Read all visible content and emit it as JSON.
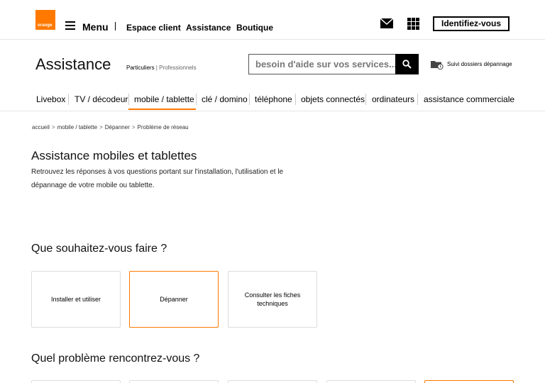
{
  "header": {
    "logo_text": "orange",
    "menu_label": "Menu",
    "links": [
      "Espace client",
      "Assistance",
      "Boutique"
    ],
    "login_label": "Identifiez-vous",
    "icons": [
      "mail-icon",
      "apps-grid-icon"
    ]
  },
  "section": {
    "title": "Assistance",
    "audience_particuliers": "Particuliers",
    "audience_sep": " | ",
    "audience_professionnels": "Professionnels",
    "search_placeholder": "besoin d'aide sur vos services...",
    "suivi_label": "Suivi dossiers dépannage"
  },
  "nav": {
    "tabs": [
      "Livebox",
      "TV / décodeur",
      "mobile / tablette",
      "clé / domino",
      "téléphone",
      "objets connectés",
      "ordinateurs",
      "assistance commerciale"
    ],
    "active": "mobile / tablette"
  },
  "breadcrumb": [
    "accueil",
    "mobile / tablette",
    "Dépanner",
    "Problème de réseau"
  ],
  "main": {
    "title": "Assistance mobiles et tablettes",
    "description": "Retrouvez les réponses à vos questions portant sur l'installation, l'utilisation et le dépannage de votre mobile ou tablette.",
    "question1": "Que souhaitez-vous faire ?",
    "cards": [
      "Installer et utiliser",
      "Dépanner",
      "Consulter les fiches techniques"
    ],
    "active_card": "Dépanner",
    "question2": "Quel problème rencontrez-vous ?"
  },
  "colors": {
    "brand": "#ff7900",
    "text": "#000000",
    "border": "#dddddd"
  }
}
